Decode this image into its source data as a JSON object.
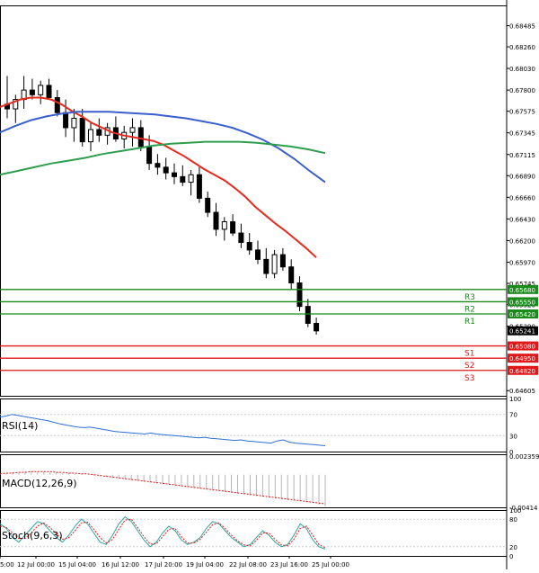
{
  "chart_data": [
    {
      "type": "candlestick",
      "panel": "price",
      "price_axis_ticks": [
        "0.68485",
        "0.68260",
        "0.68030",
        "0.67800",
        "0.67575",
        "0.67345",
        "0.67115",
        "0.66890",
        "0.66660",
        "0.66430",
        "0.66200",
        "0.65970",
        "0.65745",
        "0.65520",
        "0.65290",
        "0.64605"
      ],
      "ylim": [
        0.6455,
        0.687
      ],
      "candles": [
        {
          "o": 0.6765,
          "h": 0.6795,
          "l": 0.675,
          "c": 0.676
        },
        {
          "o": 0.676,
          "h": 0.6775,
          "l": 0.6745,
          "c": 0.677
        },
        {
          "o": 0.677,
          "h": 0.6795,
          "l": 0.676,
          "c": 0.678
        },
        {
          "o": 0.678,
          "h": 0.6792,
          "l": 0.677,
          "c": 0.6775
        },
        {
          "o": 0.6775,
          "h": 0.679,
          "l": 0.6765,
          "c": 0.6785
        },
        {
          "o": 0.6785,
          "h": 0.6792,
          "l": 0.677,
          "c": 0.6772
        },
        {
          "o": 0.6772,
          "h": 0.678,
          "l": 0.6752,
          "c": 0.6756
        },
        {
          "o": 0.6756,
          "h": 0.677,
          "l": 0.673,
          "c": 0.674
        },
        {
          "o": 0.674,
          "h": 0.676,
          "l": 0.6725,
          "c": 0.675
        },
        {
          "o": 0.675,
          "h": 0.676,
          "l": 0.672,
          "c": 0.6725
        },
        {
          "o": 0.6725,
          "h": 0.6745,
          "l": 0.6715,
          "c": 0.6738
        },
        {
          "o": 0.6738,
          "h": 0.675,
          "l": 0.6725,
          "c": 0.6732
        },
        {
          "o": 0.6732,
          "h": 0.6745,
          "l": 0.6722,
          "c": 0.674
        },
        {
          "o": 0.674,
          "h": 0.6752,
          "l": 0.6725,
          "c": 0.6728
        },
        {
          "o": 0.6728,
          "h": 0.6742,
          "l": 0.6718,
          "c": 0.6735
        },
        {
          "o": 0.6735,
          "h": 0.675,
          "l": 0.672,
          "c": 0.674
        },
        {
          "o": 0.674,
          "h": 0.6748,
          "l": 0.6715,
          "c": 0.672
        },
        {
          "o": 0.672,
          "h": 0.6732,
          "l": 0.6695,
          "c": 0.6702
        },
        {
          "o": 0.6702,
          "h": 0.6712,
          "l": 0.669,
          "c": 0.6698
        },
        {
          "o": 0.6698,
          "h": 0.6708,
          "l": 0.6685,
          "c": 0.6692
        },
        {
          "o": 0.6692,
          "h": 0.6702,
          "l": 0.668,
          "c": 0.6688
        },
        {
          "o": 0.6688,
          "h": 0.67,
          "l": 0.6678,
          "c": 0.6682
        },
        {
          "o": 0.6682,
          "h": 0.6695,
          "l": 0.6668,
          "c": 0.669
        },
        {
          "o": 0.669,
          "h": 0.6698,
          "l": 0.666,
          "c": 0.6665
        },
        {
          "o": 0.6665,
          "h": 0.6672,
          "l": 0.6645,
          "c": 0.665
        },
        {
          "o": 0.665,
          "h": 0.666,
          "l": 0.6625,
          "c": 0.6632
        },
        {
          "o": 0.6632,
          "h": 0.6645,
          "l": 0.662,
          "c": 0.664
        },
        {
          "o": 0.664,
          "h": 0.6648,
          "l": 0.6625,
          "c": 0.6628
        },
        {
          "o": 0.6628,
          "h": 0.6638,
          "l": 0.6612,
          "c": 0.6618
        },
        {
          "o": 0.6618,
          "h": 0.6628,
          "l": 0.6605,
          "c": 0.661
        },
        {
          "o": 0.661,
          "h": 0.662,
          "l": 0.6595,
          "c": 0.66
        },
        {
          "o": 0.66,
          "h": 0.6612,
          "l": 0.658,
          "c": 0.6585
        },
        {
          "o": 0.6585,
          "h": 0.661,
          "l": 0.658,
          "c": 0.6605
        },
        {
          "o": 0.6605,
          "h": 0.6612,
          "l": 0.6588,
          "c": 0.6592
        },
        {
          "o": 0.6592,
          "h": 0.66,
          "l": 0.6568,
          "c": 0.6575
        },
        {
          "o": 0.6575,
          "h": 0.6582,
          "l": 0.6545,
          "c": 0.655
        },
        {
          "o": 0.655,
          "h": 0.6558,
          "l": 0.6528,
          "c": 0.6532
        },
        {
          "o": 0.6532,
          "h": 0.6538,
          "l": 0.652,
          "c": 0.6524
        }
      ],
      "moving_averages": [
        {
          "color": "#e82a1e",
          "values": [
            0.6762,
            0.6766,
            0.677,
            0.6772,
            0.6772,
            0.677,
            0.6765,
            0.6758,
            0.6752,
            0.6745,
            0.674,
            0.6735,
            0.6732,
            0.673,
            0.6728,
            0.6726,
            0.6722,
            0.6716,
            0.671,
            0.6703,
            0.6696,
            0.669,
            0.6684,
            0.6676,
            0.6667,
            0.6656,
            0.6647,
            0.6638,
            0.663,
            0.6621,
            0.6612,
            0.6602
          ]
        },
        {
          "color": "#3a5fcd",
          "values": [
            0.6735,
            0.6742,
            0.6748,
            0.6752,
            0.6755,
            0.6757,
            0.6757,
            0.6757,
            0.6756,
            0.6755,
            0.6754,
            0.6752,
            0.675,
            0.6747,
            0.6744,
            0.674,
            0.6734,
            0.6727,
            0.6718,
            0.6707,
            0.6694,
            0.6682
          ]
        },
        {
          "color": "#2e9e4e",
          "values": [
            0.669,
            0.6694,
            0.6698,
            0.6702,
            0.6705,
            0.6708,
            0.6712,
            0.6715,
            0.6718,
            0.6721,
            0.6723,
            0.6724,
            0.6725,
            0.6725,
            0.6725,
            0.6724,
            0.6722,
            0.672,
            0.6717,
            0.6713
          ]
        }
      ],
      "levels": [
        {
          "name": "R3",
          "value": 0.6568,
          "color": "#1a8a1a",
          "label": "0.65680"
        },
        {
          "name": "R2",
          "value": 0.6555,
          "color": "#1a8a1a",
          "label": "0.65550"
        },
        {
          "name": "R1",
          "value": 0.6542,
          "color": "#1a8a1a",
          "label": "0.65420"
        },
        {
          "name": "S1",
          "value": 0.6508,
          "color": "#e0181a",
          "label": "0.65080"
        },
        {
          "name": "S2",
          "value": 0.6495,
          "color": "#e0181a",
          "label": "0.64950"
        },
        {
          "name": "S3",
          "value": 0.6482,
          "color": "#e0181a",
          "label": "0.64820"
        }
      ],
      "last_price": {
        "value": 0.65241,
        "label": "0.65241"
      },
      "x_tick_labels": [
        "5:00",
        "12 Jul 00:00",
        "15 Jul 04:00",
        "16 Jul 12:00",
        "17 Jul 20:00",
        "19 Jul 04:00",
        "22 Jul 08:00",
        "23 Jul 16:00",
        "25 Jul 00:00"
      ]
    },
    {
      "type": "line",
      "panel": "rsi",
      "label": "RSI(14)",
      "ylim": [
        0,
        100
      ],
      "ticks": [
        "100",
        "70",
        "30",
        "0"
      ],
      "values": [
        65,
        67,
        70,
        68,
        66,
        64,
        62,
        60,
        58,
        55,
        52,
        50,
        48,
        46,
        45,
        46,
        44,
        42,
        40,
        38,
        37,
        36,
        35,
        34,
        33,
        35,
        33,
        32,
        31,
        30,
        29,
        28,
        27,
        26,
        27,
        25,
        24,
        23,
        22,
        21,
        22,
        20,
        19,
        18,
        17,
        16,
        20,
        22,
        18,
        16,
        15,
        14,
        13,
        12,
        11
      ]
    },
    {
      "type": "bar",
      "panel": "macd",
      "label": "MACD(12,26,9)",
      "ylim": [
        -0.00414,
        0.00259
      ],
      "ticks": [
        "0.002359",
        "-0.00414"
      ],
      "values": [
        0.0001,
        0.0002,
        0.0003,
        0.0003,
        0.0004,
        0.0004,
        0.0004,
        0.0004,
        0.0003,
        0.0003,
        0.0002,
        0.0002,
        0.0001,
        0.0001,
        0.0,
        -0.0001,
        -0.0002,
        -0.0003,
        -0.0004,
        -0.0005,
        -0.0006,
        -0.0007,
        -0.0008,
        -0.0009,
        -0.001,
        -0.0011,
        -0.0012,
        -0.0013,
        -0.0014,
        -0.0015,
        -0.0016,
        -0.0017,
        -0.0018,
        -0.0019,
        -0.002,
        -0.0021,
        -0.0022,
        -0.0023,
        -0.0024,
        -0.0025,
        -0.0026,
        -0.0027,
        -0.0028,
        -0.0029,
        -0.003,
        -0.0031,
        -0.0032,
        -0.0033,
        -0.0034,
        -0.0035,
        -0.0036,
        -0.0038,
        -0.004
      ],
      "signal": [
        0.0001,
        0.0002,
        0.0002,
        0.0003,
        0.0003,
        0.0004,
        0.0004,
        0.0004,
        0.0004,
        0.0003,
        0.0003,
        0.0002,
        0.0002,
        0.0001,
        0.0001,
        0.0,
        -0.0001,
        -0.0002,
        -0.0003,
        -0.0004,
        -0.0005,
        -0.0006,
        -0.0007,
        -0.0008,
        -0.0009,
        -0.001,
        -0.0011,
        -0.0012,
        -0.0013,
        -0.0014,
        -0.0015,
        -0.0016,
        -0.0017,
        -0.0018,
        -0.0019,
        -0.002,
        -0.0021,
        -0.0022,
        -0.0023,
        -0.0024,
        -0.0025,
        -0.0026,
        -0.0027,
        -0.0028,
        -0.0029,
        -0.003,
        -0.0031,
        -0.0032,
        -0.0033,
        -0.0034,
        -0.0035,
        -0.0036,
        -0.0037
      ]
    },
    {
      "type": "line",
      "panel": "stoch",
      "label": "Stoch(9,6,3)",
      "ylim": [
        0,
        100
      ],
      "ticks": [
        "100",
        "80",
        "20",
        "0"
      ],
      "k": [
        70,
        60,
        40,
        30,
        45,
        60,
        75,
        70,
        55,
        40,
        30,
        45,
        65,
        80,
        70,
        50,
        30,
        25,
        45,
        70,
        85,
        75,
        55,
        35,
        20,
        30,
        50,
        65,
        55,
        35,
        25,
        30,
        40,
        60,
        75,
        70,
        55,
        40,
        30,
        20,
        25,
        40,
        55,
        45,
        30,
        20,
        25,
        45,
        70,
        60,
        35,
        20,
        15
      ],
      "d": [
        65,
        62,
        50,
        38,
        38,
        50,
        65,
        72,
        62,
        48,
        36,
        40,
        55,
        72,
        74,
        58,
        40,
        28,
        36,
        58,
        78,
        80,
        62,
        42,
        26,
        26,
        42,
        58,
        60,
        42,
        28,
        28,
        36,
        52,
        68,
        72,
        60,
        45,
        33,
        24,
        22,
        34,
        50,
        50,
        36,
        24,
        22,
        36,
        60,
        65,
        45,
        25,
        18
      ]
    }
  ]
}
